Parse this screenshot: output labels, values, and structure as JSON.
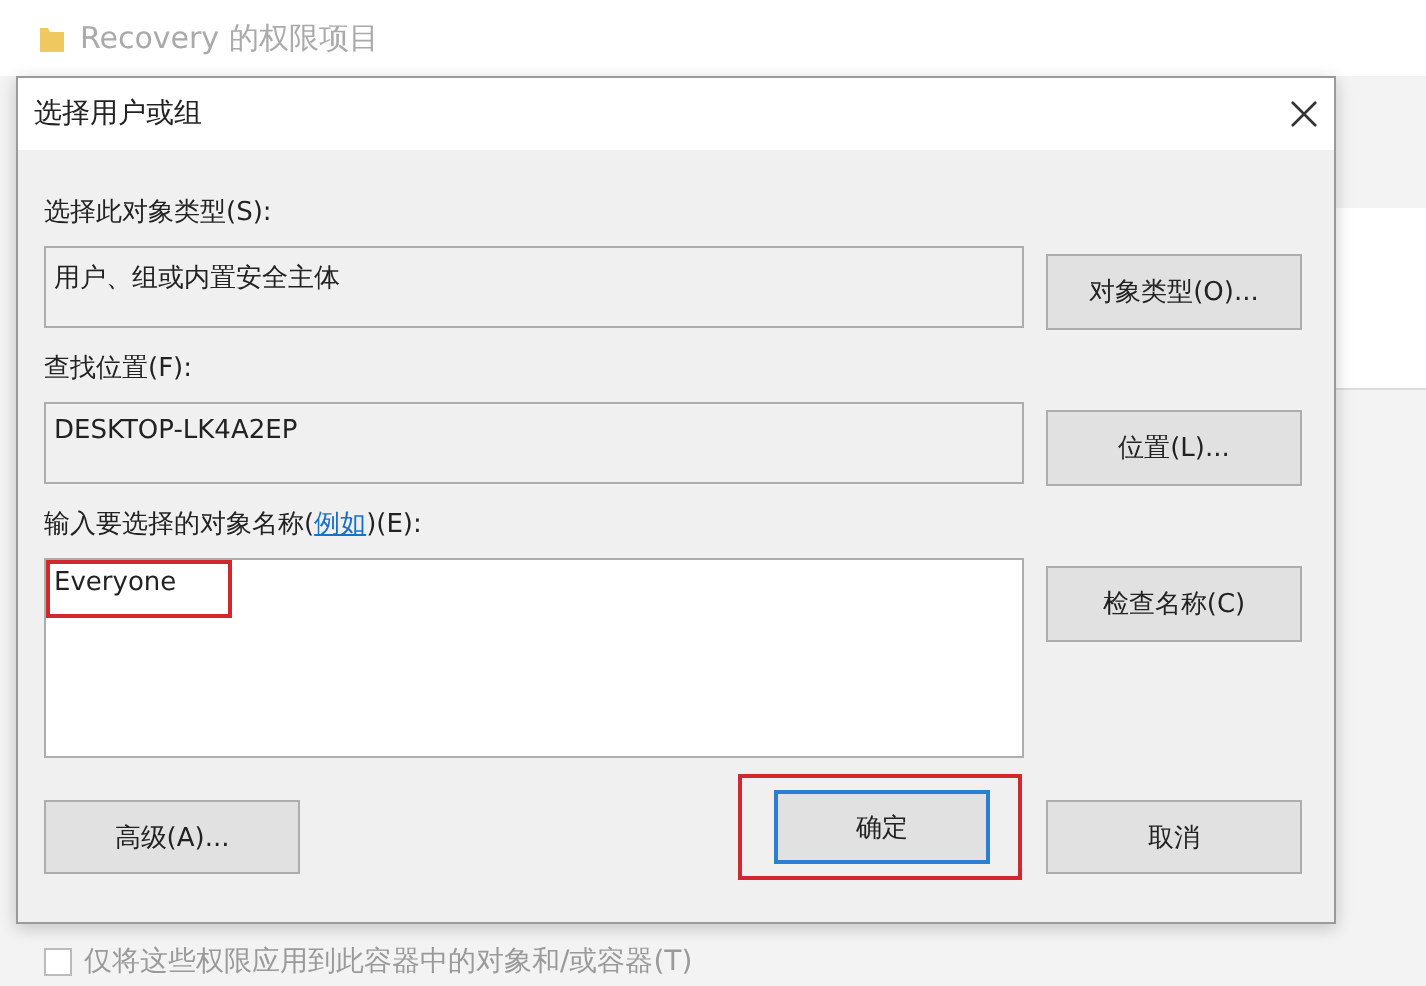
{
  "background_window": {
    "title": "Recovery 的权限项目",
    "checkbox": {
      "label": "仅将这些权限应用到此容器中的对象和/或容器(T)",
      "checked": false,
      "disabled": true
    }
  },
  "dialog": {
    "title": "选择用户或组",
    "sections": [
      {
        "label": "选择此对象类型(S):",
        "value": "用户、组或内置安全主体",
        "button": "对象类型(O)..."
      },
      {
        "label": "查找位置(F):",
        "value": "DESKTOP-LK4A2EP",
        "button": "位置(L)..."
      }
    ],
    "names": {
      "label_before": "输入要选择的对象名称(",
      "link": "例如",
      "label_after": ")(E):",
      "value": "Everyone",
      "highlighted": true,
      "button": "检查名称(C)"
    },
    "buttons": [
      {
        "label": "高级(A)...",
        "default": false,
        "highlighted": false
      },
      {
        "label": "确定",
        "default": true,
        "highlighted": true
      },
      {
        "label": "取消",
        "default": false,
        "highlighted": false
      }
    ]
  }
}
